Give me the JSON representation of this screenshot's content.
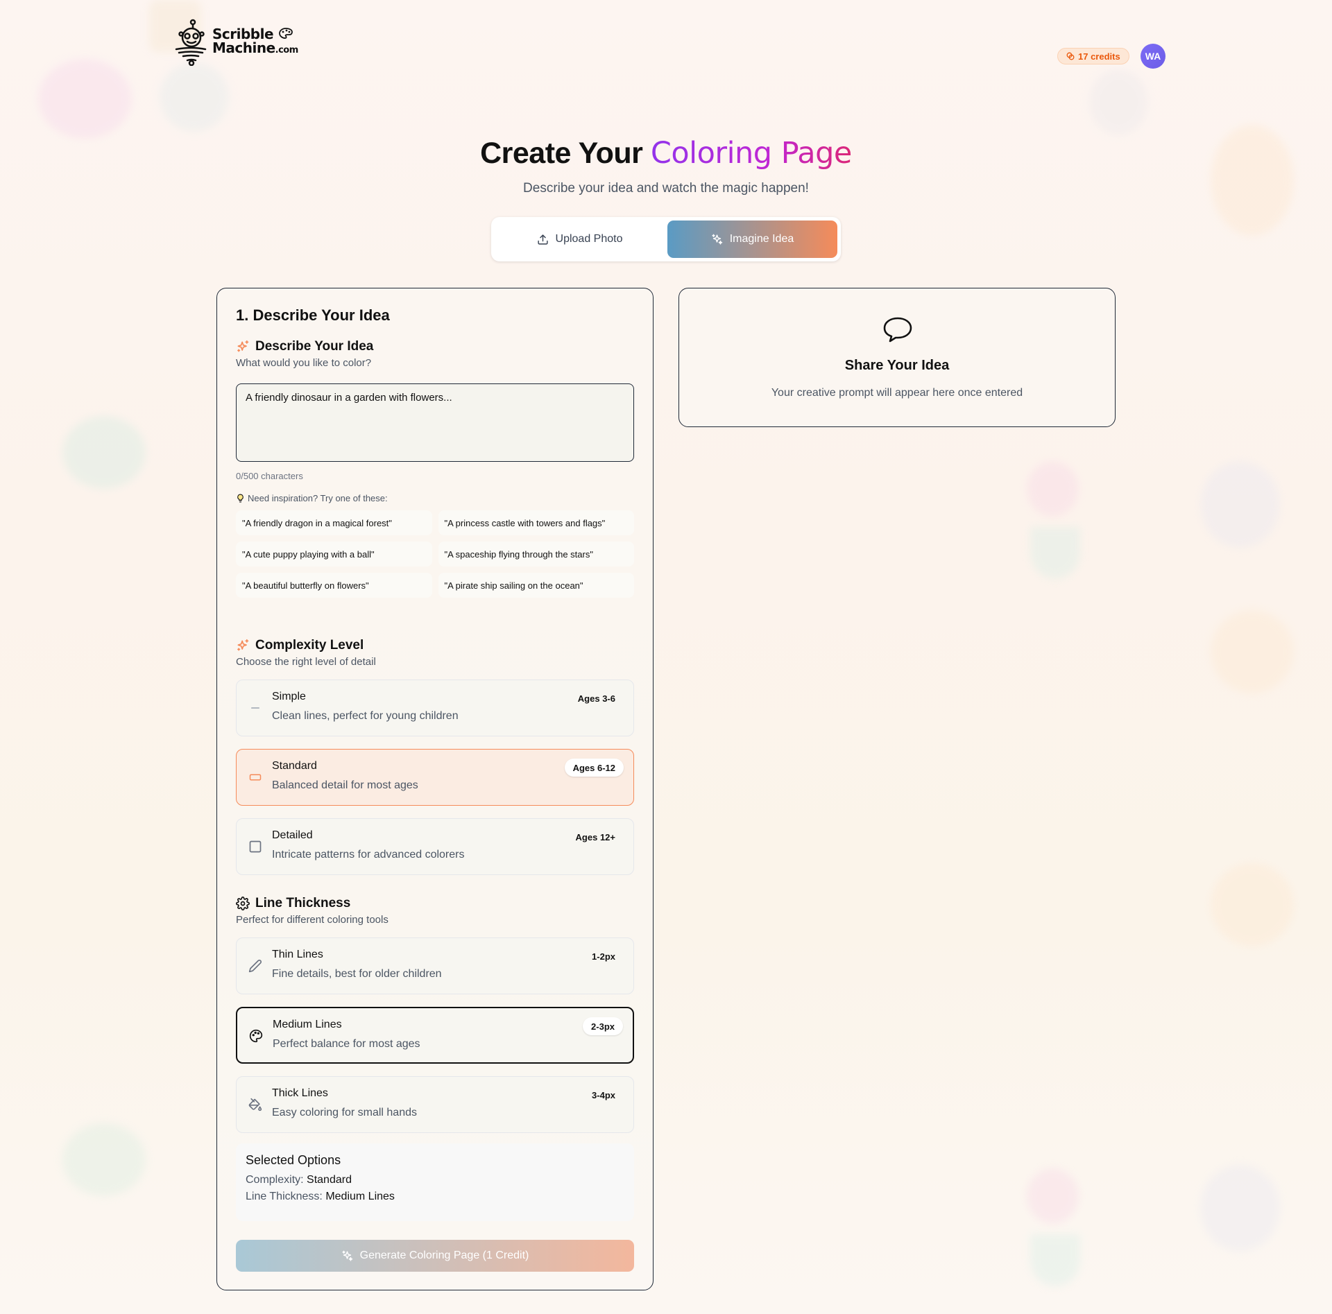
{
  "header": {
    "logo_line1": "Scribble",
    "logo_line2": "Machine",
    "logo_suffix": ".com",
    "credits": "17 credits",
    "avatar_initials": "WA"
  },
  "hero": {
    "title_plain": "Create Your ",
    "title_accent": "Coloring Page",
    "subtitle": "Describe your idea and watch the magic happen!"
  },
  "mode_tabs": [
    {
      "label": "Upload Photo",
      "icon": "upload-icon",
      "active": false
    },
    {
      "label": "Imagine Idea",
      "icon": "sparkles-icon",
      "active": true
    }
  ],
  "form": {
    "title": "1. Describe Your Idea",
    "describe": {
      "heading": "Describe Your Idea",
      "subheading": "What would you like to color?",
      "placeholder": "A friendly dinosaur in a garden with flowers...",
      "value": "",
      "char_count": "0/500 characters",
      "inspiration_label": "Need inspiration? Try one of these:",
      "suggestions": [
        "\"A friendly dragon in a magical forest\"",
        "\"A princess castle with towers and flags\"",
        "\"A cute puppy playing with a ball\"",
        "\"A spaceship flying through the stars\"",
        "\"A beautiful butterfly on flowers\"",
        "\"A pirate ship sailing on the ocean\""
      ]
    },
    "complexity": {
      "heading": "Complexity Level",
      "subheading": "Choose the right level of detail",
      "options": [
        {
          "name": "Simple",
          "desc": "Clean lines, perfect for young children",
          "badge": "Ages 3-6",
          "icon": "minus-icon",
          "selected": false
        },
        {
          "name": "Standard",
          "desc": "Balanced detail for most ages",
          "badge": "Ages 6-12",
          "icon": "rectangle-icon",
          "selected": true
        },
        {
          "name": "Detailed",
          "desc": "Intricate patterns for advanced colorers",
          "badge": "Ages 12+",
          "icon": "square-icon",
          "selected": false
        }
      ]
    },
    "thickness": {
      "heading": "Line Thickness",
      "subheading": "Perfect for different coloring tools",
      "options": [
        {
          "name": "Thin Lines",
          "desc": "Fine details, best for older children",
          "badge": "1-2px",
          "icon": "pencil-icon",
          "selected": false
        },
        {
          "name": "Medium Lines",
          "desc": "Perfect balance for most ages",
          "badge": "2-3px",
          "icon": "palette-icon",
          "selected": true
        },
        {
          "name": "Thick Lines",
          "desc": "Easy coloring for small hands",
          "badge": "3-4px",
          "icon": "paint-bucket-icon",
          "selected": false
        }
      ]
    },
    "summary": {
      "title": "Selected Options",
      "complexity_label": "Complexity:",
      "complexity_value": "Standard",
      "thickness_label": "Line Thickness:",
      "thickness_value": "Medium Lines"
    },
    "generate_label": "Generate Coloring Page (1 Credit)"
  },
  "preview": {
    "title": "Share Your Idea",
    "subtitle": "Your creative prompt will appear here once entered",
    "icon": "speech-bubble-icon"
  },
  "colors": {
    "accent_orange": "#f58b5a",
    "accent_blue": "#5a9bc4",
    "credits_text": "#ea580c",
    "avatar": "#7c6cf5"
  }
}
